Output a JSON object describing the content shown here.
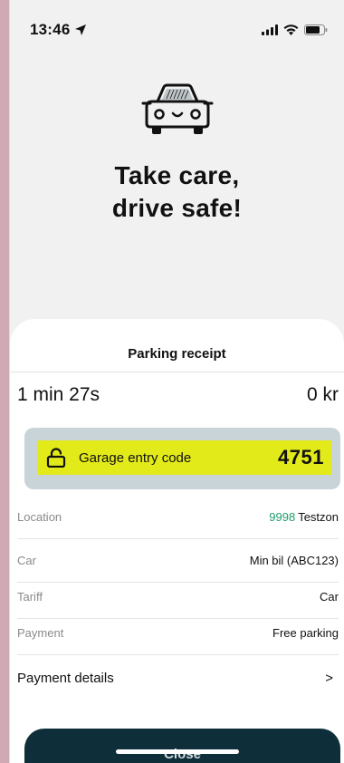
{
  "status_bar": {
    "time": "13:46",
    "icons": [
      "location-arrow-icon",
      "signal-icon",
      "wifi-icon",
      "battery-icon"
    ]
  },
  "hero": {
    "icon": "car-icon",
    "tagline_line1": "Take care,",
    "tagline_line2": "drive safe!"
  },
  "receipt": {
    "title": "Parking receipt",
    "duration": "1 min 27s",
    "amount": "0 kr",
    "garage_code": {
      "icon": "unlock-icon",
      "label": "Garage entry code",
      "value": "4751",
      "highlight_color": "#e3ea1a"
    },
    "rows": [
      {
        "label": "Location",
        "code": "9998",
        "value": "Testzon"
      },
      {
        "label": "Car",
        "value": "Min bil (ABC123)"
      },
      {
        "label": "Tariff",
        "value": "Car"
      },
      {
        "label": "Payment",
        "value": "Free parking"
      }
    ],
    "details_label": "Payment details",
    "details_chevron": ">"
  },
  "close_button": {
    "label": "Close",
    "color": "#0e2f3a"
  }
}
